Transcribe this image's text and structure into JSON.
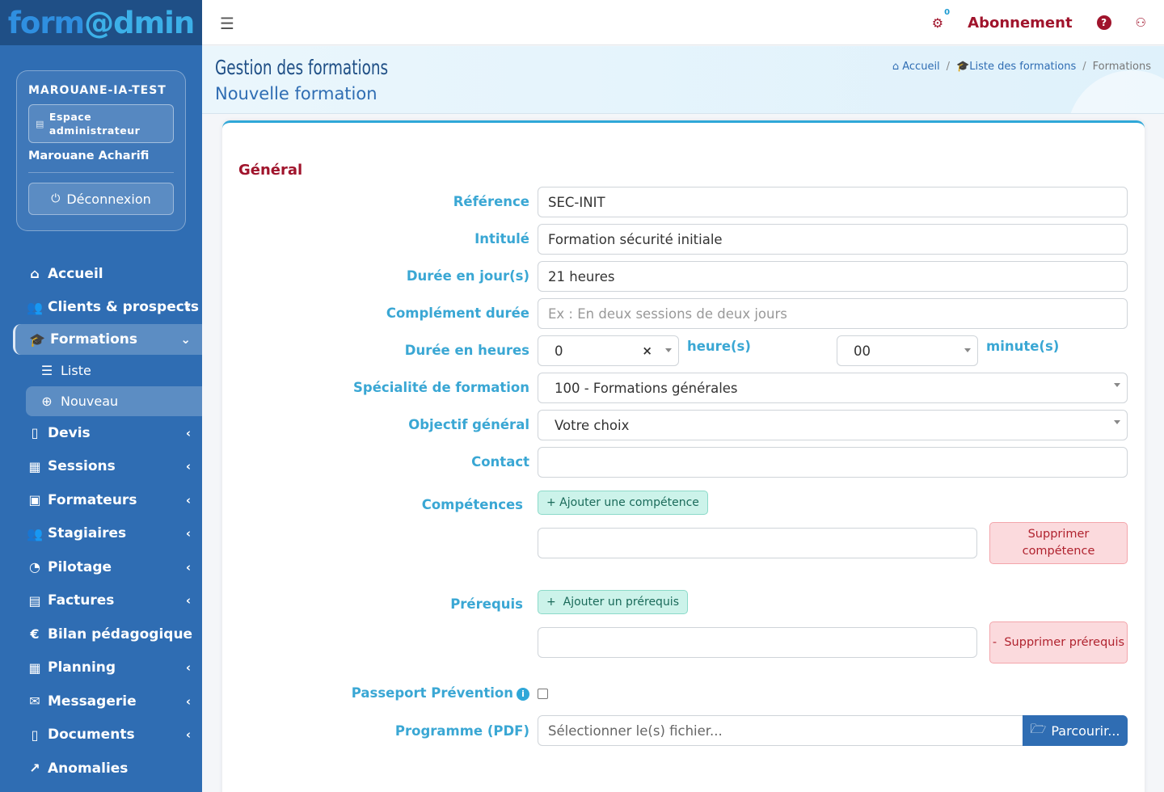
{
  "brand": {
    "part1": "form",
    "part2": "@dmin"
  },
  "user": {
    "org": "MAROUANE-IA-TEST",
    "space": "Espace administrateur",
    "name": "Marouane Acharifi",
    "logout": "Déconnexion"
  },
  "nav": {
    "accueil": "Accueil",
    "clients": "Clients & prospects",
    "formations": "Formations",
    "liste": "Liste",
    "nouveau": "Nouveau",
    "devis": "Devis",
    "sessions": "Sessions",
    "formateurs": "Formateurs",
    "stagiaires": "Stagiaires",
    "pilotage": "Pilotage",
    "factures": "Factures",
    "bilan": "Bilan pédagogique",
    "planning": "Planning",
    "messagerie": "Messagerie",
    "documents": "Documents",
    "anomalies": "Anomalies"
  },
  "topbar": {
    "notif_count": "0",
    "abonnement": "Abonnement"
  },
  "header": {
    "title": "Gestion des formations",
    "subtitle": "Nouvelle formation",
    "breadcrumb": {
      "home": "Accueil",
      "list": "Liste des formations",
      "current": "Formations"
    }
  },
  "form": {
    "section": "Général",
    "reference": {
      "label": "Référence",
      "value": "SEC-INIT"
    },
    "intitule": {
      "label": "Intitulé",
      "value": "Formation sécurité initiale"
    },
    "duree_jours": {
      "label": "Durée en jour(s)",
      "value": "21 heures"
    },
    "complement": {
      "label": "Complément durée",
      "placeholder": "Ex : En deux sessions de deux jours"
    },
    "duree_heures": {
      "label": "Durée en heures",
      "hours": "0",
      "hours_clear": "×",
      "hours_unit": "heure(s)",
      "minutes": "00",
      "minutes_unit": "minute(s)"
    },
    "specialite": {
      "label": "Spécialité de formation",
      "value": "100 - Formations générales"
    },
    "objectif": {
      "label": "Objectif général",
      "value": "Votre choix"
    },
    "contact": {
      "label": "Contact",
      "value": ""
    },
    "competences": {
      "label": "Compétences",
      "add": "+ Ajouter une compétence",
      "delete": "Supprimer compétence"
    },
    "prerequis": {
      "label": "Prérequis",
      "add": "+  Ajouter un prérequis",
      "delete": "-  Supprimer prérequis"
    },
    "passeport": {
      "label": "Passeport Prévention",
      "info": "i"
    },
    "programme": {
      "label": "Programme (PDF)",
      "placeholder": "Sélectionner le(s) fichier...",
      "browse": "Parcourir..."
    }
  }
}
